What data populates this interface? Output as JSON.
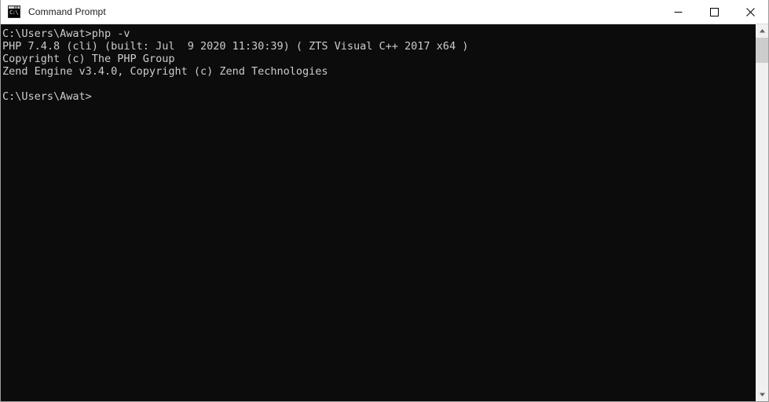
{
  "window": {
    "title": "Command Prompt",
    "icon": "console-icon",
    "icon_text": "C:\\",
    "background_color": "#0c0c0c",
    "titlebar_color": "#ffffff",
    "text_color": "#cccccc"
  },
  "window_controls": {
    "minimize": {
      "name": "minimize-button",
      "label": "Minimize"
    },
    "maximize": {
      "name": "maximize-button",
      "label": "Maximize"
    },
    "close": {
      "name": "close-button",
      "label": "Close"
    }
  },
  "console": {
    "lines": [
      "C:\\Users\\Awat>php -v",
      "PHP 7.4.8 (cli) (built: Jul  9 2020 11:30:39) ( ZTS Visual C++ 2017 x64 )",
      "Copyright (c) The PHP Group",
      "Zend Engine v3.4.0, Copyright (c) Zend Technologies",
      "",
      "C:\\Users\\Awat>"
    ]
  },
  "scrollbar": {
    "up_arrow": "scroll-up-arrow",
    "down_arrow": "scroll-down-arrow",
    "thumb": "scroll-thumb"
  }
}
